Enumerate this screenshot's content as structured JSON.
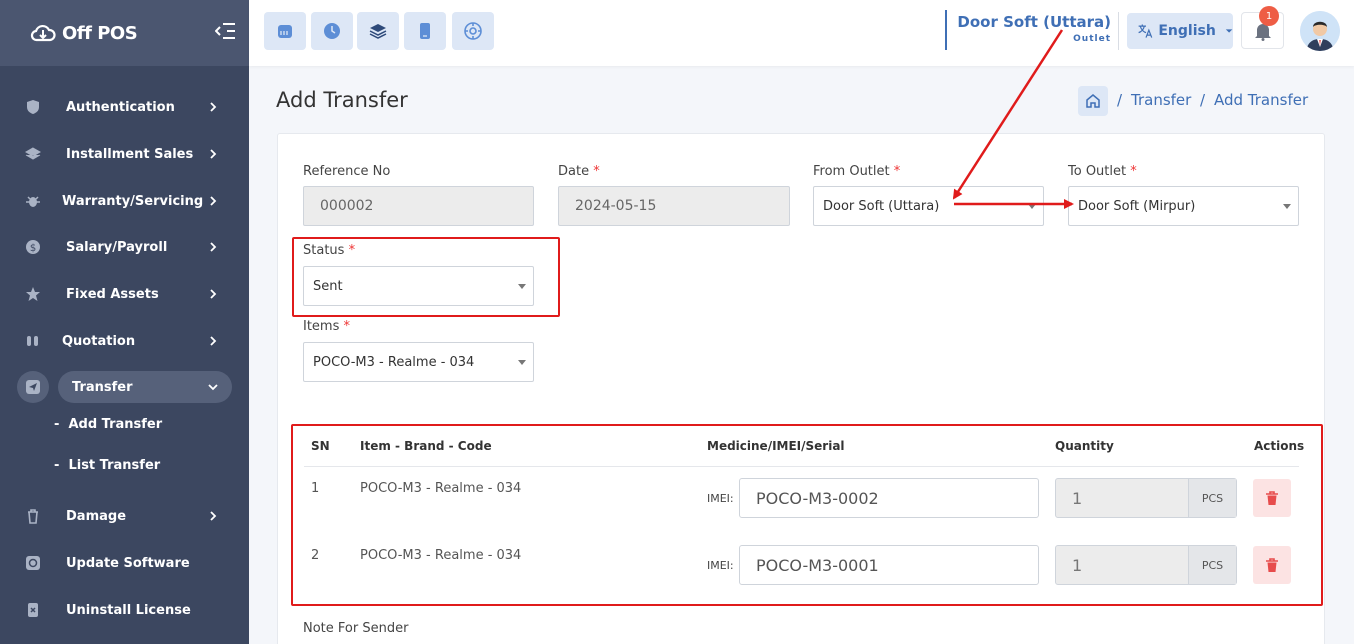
{
  "app": {
    "brand": "Off POS"
  },
  "sidebar": {
    "items": [
      {
        "label": "Authentication",
        "icon": "shield-icon"
      },
      {
        "label": "Installment Sales",
        "icon": "layers-icon"
      },
      {
        "label": "Warranty/Servicing",
        "icon": "bug-icon"
      },
      {
        "label": "Salary/Payroll",
        "icon": "dollar-icon"
      },
      {
        "label": "Fixed Assets",
        "icon": "star-icon"
      },
      {
        "label": "Quotation",
        "icon": "quote-icon"
      },
      {
        "label": "Transfer",
        "icon": "send-icon"
      },
      {
        "label": "Damage",
        "icon": "trash-icon"
      },
      {
        "label": "Update Software",
        "icon": "refresh-icon"
      },
      {
        "label": "Uninstall License",
        "icon": "license-icon"
      }
    ],
    "transfer_sub": [
      "Add Transfer",
      "List Transfer"
    ]
  },
  "topbar": {
    "quick_icons": [
      "store-icon",
      "clock-icon",
      "stack-icon",
      "mobile-icon",
      "compass-icon"
    ],
    "outlet_name": "Door Soft (Uttara)",
    "outlet_sub": "Outlet",
    "language": "English",
    "notifications": "1"
  },
  "page": {
    "title": "Add Transfer",
    "breadcrumb": [
      "Transfer",
      "Add Transfer"
    ]
  },
  "form": {
    "reference_label": "Reference No",
    "reference_value": "000002",
    "date_label": "Date",
    "date_value": "2024-05-15",
    "from_label": "From Outlet",
    "from_value": "Door Soft (Uttara)",
    "to_label": "To Outlet",
    "to_value": "Door Soft (Mirpur)",
    "status_label": "Status",
    "status_value": "Sent",
    "items_label": "Items",
    "items_value": "POCO-M3 - Realme - 034",
    "note_label": "Note For Sender",
    "required_mark": "*"
  },
  "table": {
    "headers": [
      "SN",
      "Item - Brand - Code",
      "Medicine/IMEI/Serial",
      "Quantity",
      "Actions"
    ],
    "imei_label": "IMEI:",
    "rows": [
      {
        "sn": "1",
        "item": "POCO-M3 - Realme - 034",
        "imei": "POCO-M3-0002",
        "qty": "1",
        "unit": "PCS"
      },
      {
        "sn": "2",
        "item": "POCO-M3 - Realme - 034",
        "imei": "POCO-M3-0001",
        "qty": "1",
        "unit": "PCS"
      }
    ]
  },
  "colors": {
    "accent": "#3f6fb5",
    "sidebar": "#3c4760",
    "annotation": "#e01b1b"
  }
}
